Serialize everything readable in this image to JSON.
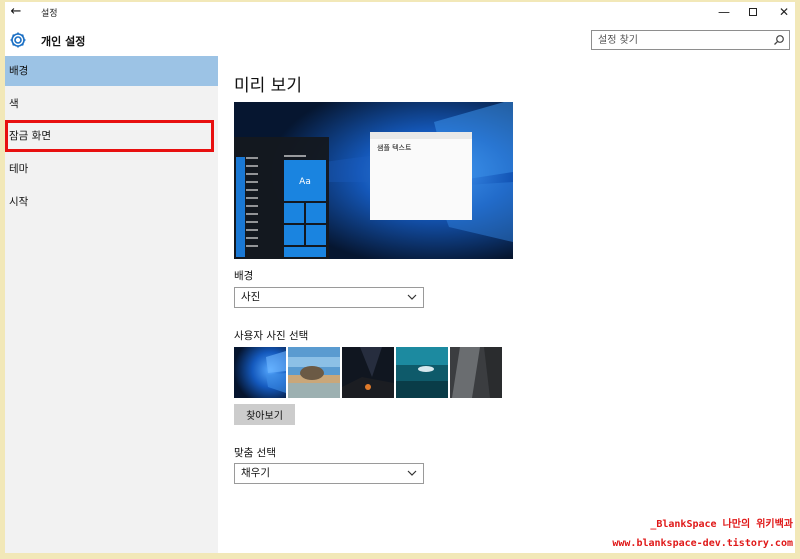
{
  "window": {
    "title": "설정",
    "back_glyph": "←",
    "minimize_glyph": "—",
    "close_glyph": "✕"
  },
  "header": {
    "title": "개인 설정",
    "search_placeholder": "설정 찾기"
  },
  "sidebar": {
    "items": [
      {
        "label": "배경",
        "state": "selected"
      },
      {
        "label": "색"
      },
      {
        "label": "잠금 화면",
        "state": "highlighted"
      },
      {
        "label": "테마"
      },
      {
        "label": "시작"
      }
    ]
  },
  "main": {
    "title": "미리 보기",
    "preview": {
      "sample_text": "샘플 텍스트",
      "tile_text": "Aa"
    },
    "background_label": "배경",
    "background_value": "사진",
    "picture_label": "사용자 사진 선택",
    "browse_label": "찾아보기",
    "fit_label": "맞춤 선택",
    "fit_value": "채우기"
  },
  "watermark": {
    "line1": "_BlankSpace 나만의 위키백과",
    "line2": "www.blankspace-dev.tistory.com"
  },
  "colors": {
    "accent": "#9cc3e5",
    "highlight_box": "#e81010",
    "watermark": "#e01818"
  }
}
